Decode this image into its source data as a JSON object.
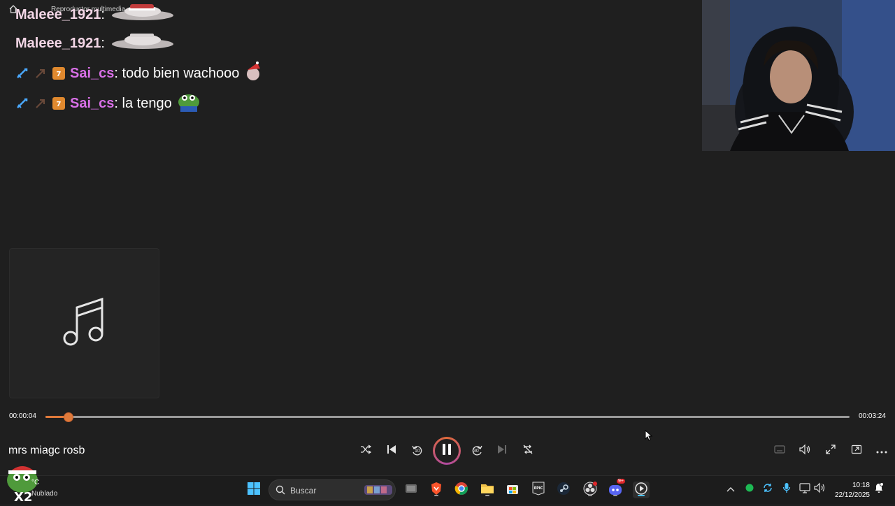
{
  "window": {
    "title": "Reproductor multimedia"
  },
  "chat": [
    {
      "user": "Maleee_1921",
      "message": "",
      "emote": "cat-santa-emote"
    },
    {
      "user": "Maleee_1921",
      "message": "",
      "emote": "cat-santa-emote"
    },
    {
      "user": "Sai_cs",
      "message": "todo bien wachooo",
      "emote": "santa-emote"
    },
    {
      "user": "Sai_cs",
      "message": "la tengo",
      "emote": "pepe-emote"
    }
  ],
  "player": {
    "current_time": "00:00:04",
    "total_time": "00:03:24",
    "progress": 0.028,
    "song_title": "mrs miagc rosb",
    "controls": {
      "shuffle": "shuffle-icon",
      "previous": "previous-icon",
      "rewind": "10",
      "play_pause": "pause-icon",
      "forward": "30",
      "next": "next-icon",
      "repeat": "repeat-off-icon"
    }
  },
  "taskbar": {
    "weather": {
      "temp": "°C",
      "desc": "Nublado"
    },
    "search_placeholder": "Buscar",
    "discord_badge": "9+",
    "clock": {
      "time": "10:18",
      "date": "22/12/2025"
    }
  },
  "colors": {
    "accent": "#e07a3a",
    "background": "#1f1f1f",
    "taskbar": "#1c1c1c",
    "sai_name": "#d86fe6"
  }
}
